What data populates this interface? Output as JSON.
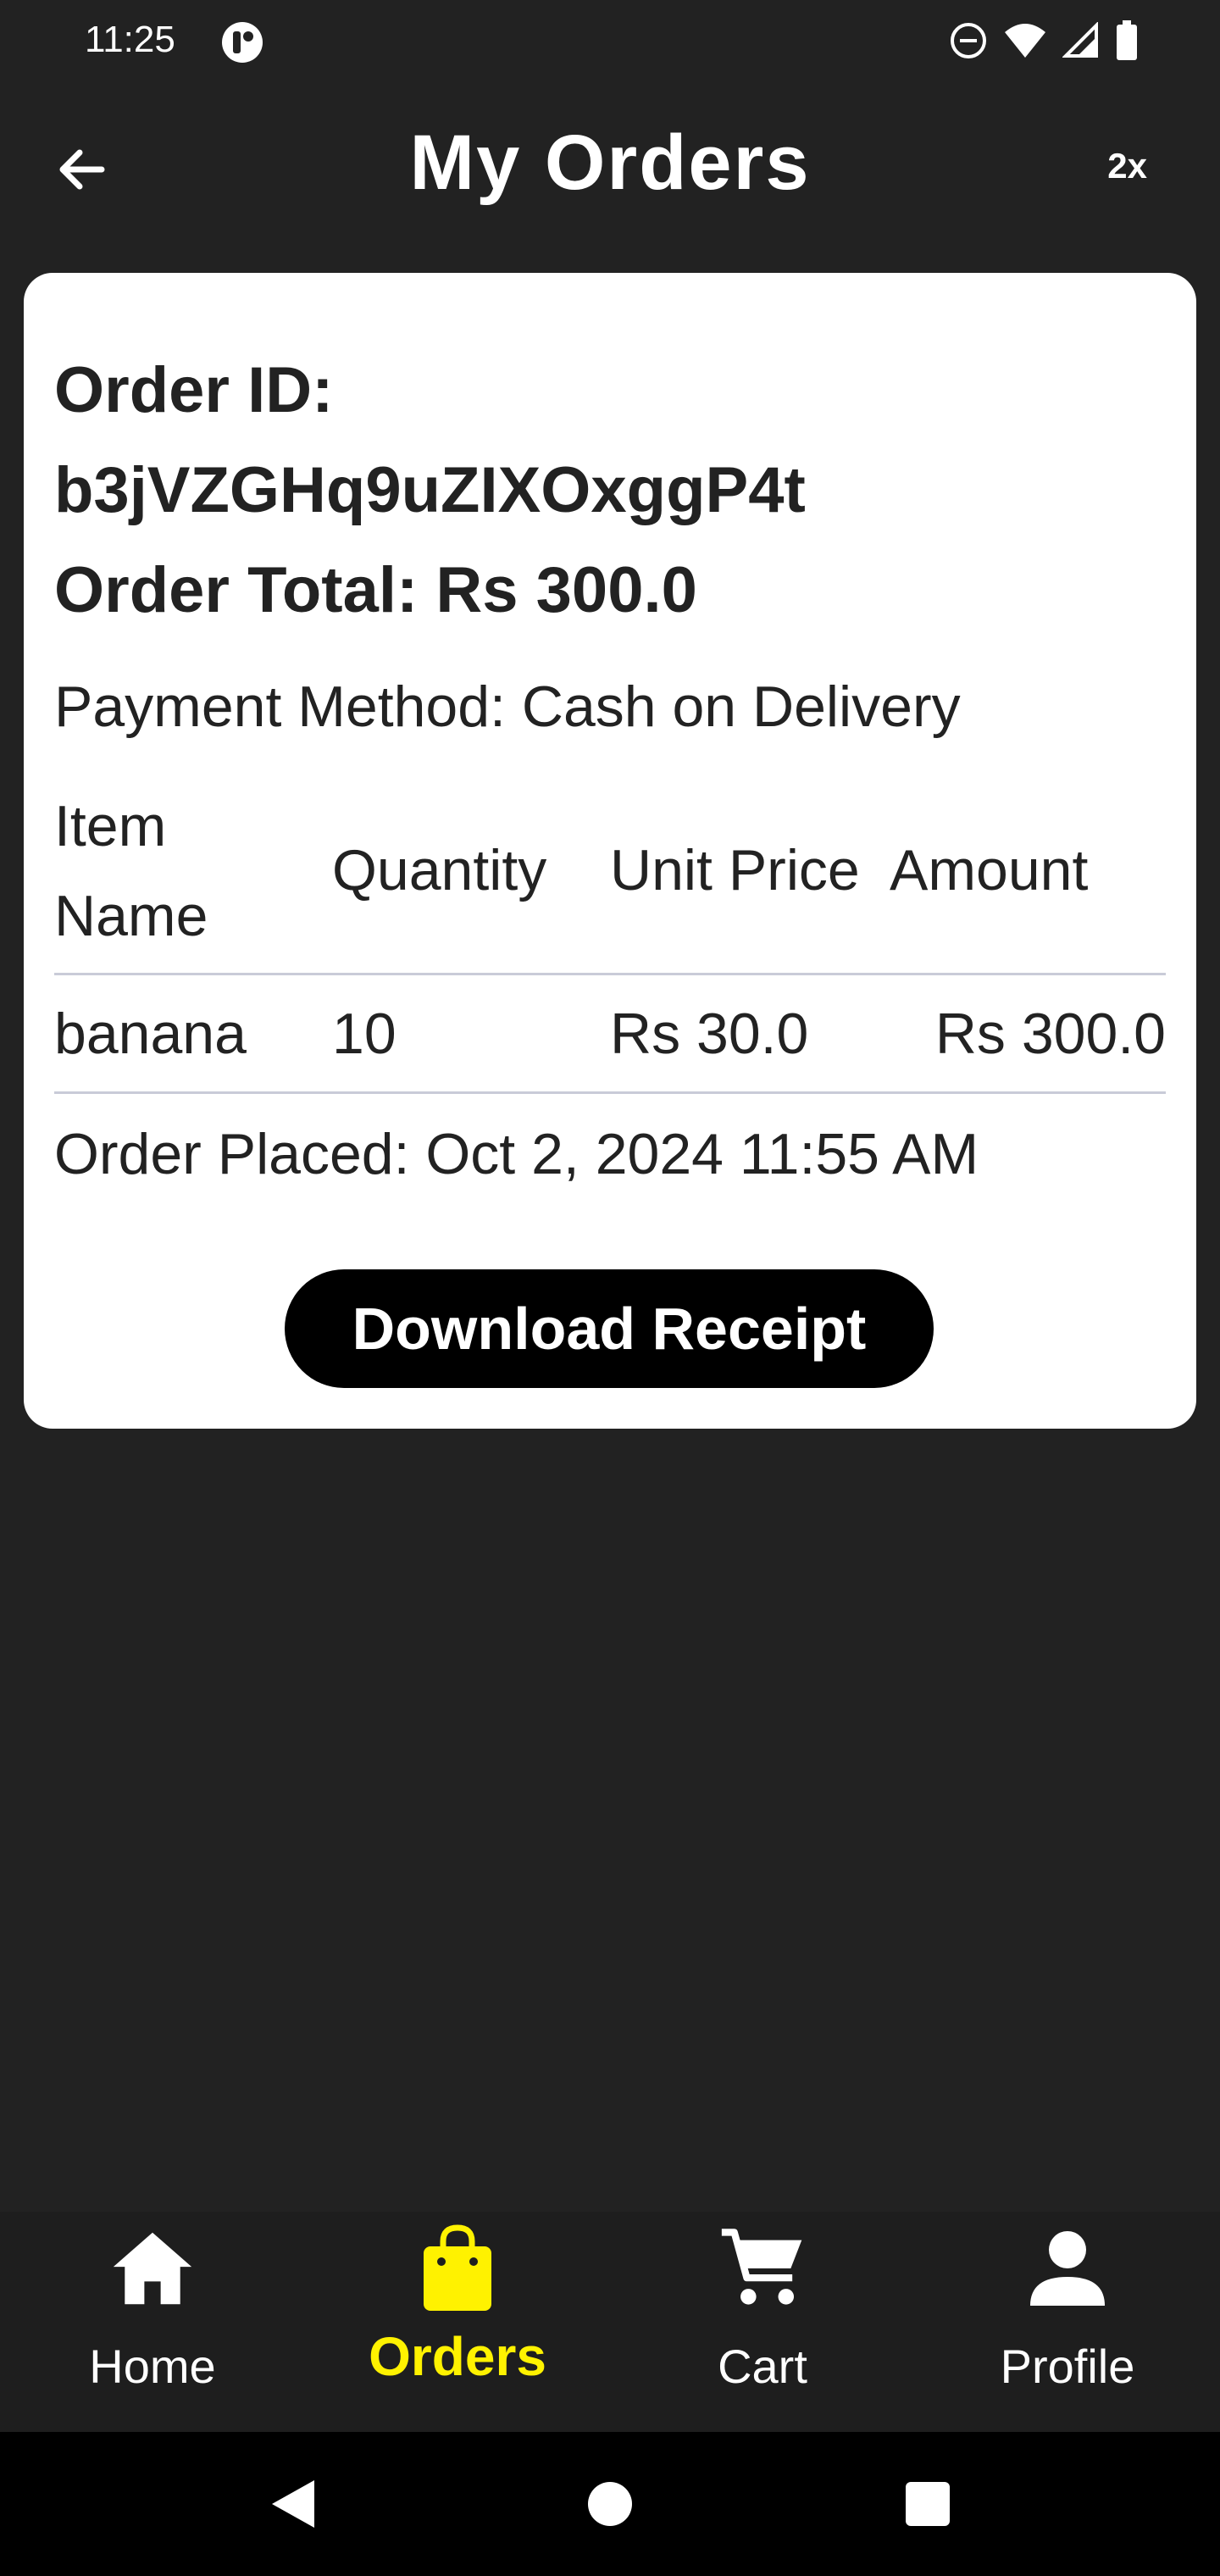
{
  "status_bar": {
    "time": "11:25"
  },
  "app_bar": {
    "title": "My Orders",
    "speed_badge": "2x"
  },
  "order": {
    "id_label": "Order ID:",
    "id_value": "b3jVZGHq9uZIXOxggP4t",
    "total": "Order Total: Rs 300.0",
    "payment_method": "Payment Method: Cash on Delivery",
    "table": {
      "headers": [
        "Item Name",
        "Quantity",
        "Unit Price",
        "Amount"
      ],
      "rows": [
        [
          "banana",
          "10",
          "Rs 30.0",
          "Rs 300.0"
        ]
      ]
    },
    "placed": "Order Placed: Oct 2, 2024 11:55 AM",
    "download_label": "Download Receipt"
  },
  "bottom_nav": {
    "items": [
      {
        "label": "Home",
        "icon": "home-icon"
      },
      {
        "label": "Orders",
        "icon": "shopping-bag-icon",
        "active": true
      },
      {
        "label": "Cart",
        "icon": "cart-icon"
      },
      {
        "label": "Profile",
        "icon": "person-icon"
      }
    ]
  },
  "colors": {
    "background": "#222222",
    "card": "#ffffff",
    "accent_active": "#fff200",
    "button": "#000000"
  }
}
